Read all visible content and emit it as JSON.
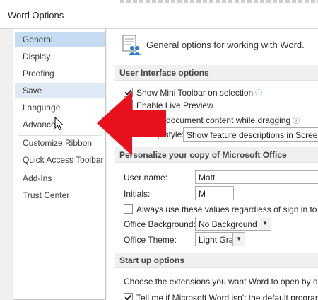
{
  "window": {
    "title": "Word Options"
  },
  "sidebar": {
    "items": [
      {
        "label": "General"
      },
      {
        "label": "Display"
      },
      {
        "label": "Proofing"
      },
      {
        "label": "Save"
      },
      {
        "label": "Language"
      },
      {
        "label": "Advanced"
      },
      {
        "label": "Customize Ribbon"
      },
      {
        "label": "Quick Access Toolbar"
      },
      {
        "label": "Add-Ins"
      },
      {
        "label": "Trust Center"
      }
    ],
    "selected": "General",
    "hovered": "Save"
  },
  "general": {
    "title": "General options for working with Word.",
    "ui_options": {
      "header": "User Interface options",
      "mini_toolbar": "Show Mini Toolbar on selection",
      "live_preview": "Enable Live Preview",
      "update_dragging": "Update document content while dragging",
      "screentip_label": "ScreenTip style:",
      "screentip_value": "Show feature descriptions in ScreenTips"
    },
    "personalize": {
      "header": "Personalize your copy of Microsoft Office",
      "username_label": "User name:",
      "username_value": "Matt",
      "initials_label": "Initials:",
      "initials_value": "M",
      "always_use": "Always use these values regardless of sign in to Office.",
      "background_label": "Office Background:",
      "background_value": "No Background",
      "theme_label": "Office Theme:",
      "theme_value": "Light Gray"
    },
    "startup": {
      "header": "Start up options",
      "extensions": "Choose the extensions you want Word to open by default:",
      "tell_me": "Tell me if Microsoft Word isn't the default program for"
    }
  },
  "colors": {
    "selected_bg": "#c5dcf2",
    "hover_bg": "#dfeaf6",
    "arrow": "#e8101c"
  }
}
